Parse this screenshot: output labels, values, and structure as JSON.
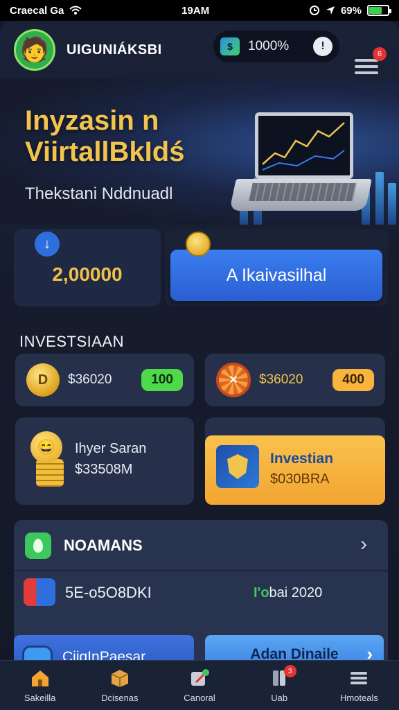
{
  "status_bar": {
    "carrier": "Craecal Ga",
    "time": "19AM",
    "battery_percent": "69%"
  },
  "header": {
    "brand": "UIGUNIÁKSBI",
    "balance": "1000%",
    "menu_badge": "6"
  },
  "hero": {
    "title_line1": "Inyzasin n",
    "title_line2": "ViirtallBkIdś",
    "subtitle": "Thekstani Nddnuadl"
  },
  "summary": {
    "stat_value": "2,00000",
    "action_label": "A Ikaivasilhal"
  },
  "investments": {
    "section_title": "INVESTSIAAN",
    "items": [
      {
        "amount": "$36020",
        "badge": "100",
        "badge_color": "#4ed94a"
      },
      {
        "amount": "$36020",
        "badge": "400",
        "badge_color": "#f7b53d"
      }
    ],
    "feature": {
      "line1": "Ihyer Saran",
      "line2": "$33508M"
    },
    "promo": {
      "line1": "Investian",
      "line2": "$030BRA"
    }
  },
  "panel": {
    "title": "NOAMANS",
    "row_left": "5E-o5O8DKI",
    "row_right_prefix": "I'o",
    "row_right": "bai 2020",
    "button_left": "CiigInPaesar",
    "button_right": "Adan Dinaile"
  },
  "tabbar": {
    "tabs": [
      {
        "label": "Sakeilla"
      },
      {
        "label": "Dcisenas"
      },
      {
        "label": "Canoral"
      },
      {
        "label": "Uab"
      },
      {
        "label": "Hmoteals"
      }
    ],
    "badge_uab": "3"
  },
  "colors": {
    "accent_gold": "#f2c44e",
    "accent_blue": "#3a7ef0",
    "accent_green": "#4ed94a",
    "accent_orange": "#f7b53d"
  }
}
